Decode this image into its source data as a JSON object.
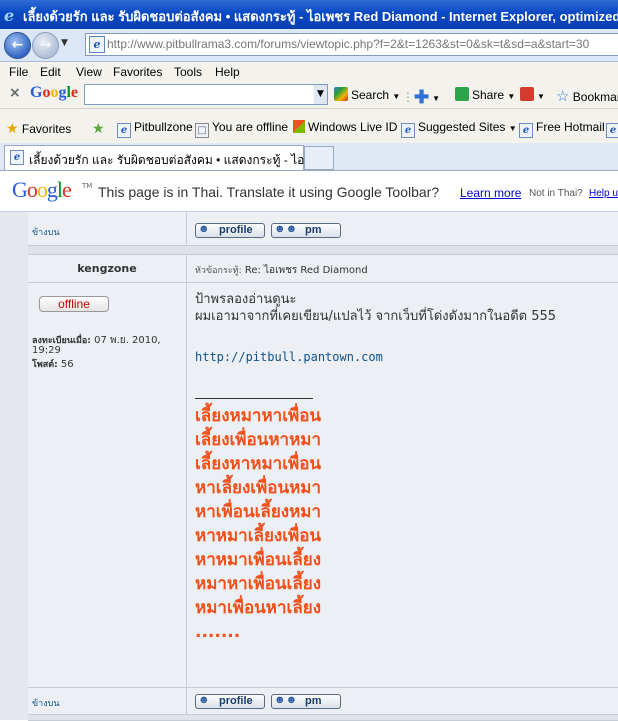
{
  "window": {
    "title": "เลี้ยงด้วยรัก และ รับผิดชอบต่อสังคม • แสดงกระทู้ - ไอเพชร Red Diamond - Internet Explorer, optimized"
  },
  "address": {
    "url": "http://www.pitbullrama3.com/forums/viewtopic.php?f=2&t=1263&st=0&sk=t&sd=a&start=30"
  },
  "menu": [
    "File",
    "Edit",
    "View",
    "Favorites",
    "Tools",
    "Help"
  ],
  "google_toolbar": {
    "logo": "Google",
    "search_label": "Search",
    "share_label": "Share",
    "bookmarks_label": "Bookmar"
  },
  "favorites_bar": {
    "favorites_label": "Favorites",
    "items": [
      "Pitbullzone",
      "You are offline",
      "Windows Live ID",
      "Suggested Sites",
      "Free Hotmail"
    ]
  },
  "tab": {
    "label": "เลี้ยงด้วยรัก และ รับผิดชอบต่อสังคม • แสดงกระทู้ - ไอเ..."
  },
  "translate_bar": {
    "logo": "Google",
    "tm": "TM",
    "message": "This page is in Thai.  Translate it using Google Toolbar?",
    "learn_more": "Learn more",
    "not_thai": "Not in Thai?",
    "help": "Help u"
  },
  "forum": {
    "back_to_top": "ข้างบน",
    "profile_label": "profile",
    "pm_label": "pm",
    "post": {
      "author": "kengzone",
      "subject_label": "หัวข้อกระทู้:",
      "subject": "Re: ไอเพชร Red Diamond",
      "status": "offline",
      "joined_label": "ลงทะเบียนเมื่อ:",
      "joined_value": "07 พ.ย. 2010,",
      "joined_time": "19:29",
      "posts_label": "โพสต์:",
      "posts_value": "56",
      "body_line1": "ป้าพรลองอ่านดูนะ",
      "body_line2": "ผมเอามาจากที่เคยเขียน/แปลไว้ จากเว็บที่โด่งดังมากในอดีต 555",
      "link": "http://pitbull.pantown.com",
      "signature": [
        "เลี้ยงหมาหาเพื่อน",
        "เลี้ยงเพื่อนหาหมา",
        "เลี้ยงหาหมาเพื่อน",
        "หาเลี้ยงเพื่อนหมา",
        "หาเพื่อนเลี้ยงหมา",
        "หาหมาเลี้ยงเพื่อน",
        "หาหมาเพื่อนเลี้ยง",
        "หมาหาเพื่อนเลี้ยง",
        "หมาเพื่อนหาเลี้ยง",
        "......."
      ]
    }
  }
}
